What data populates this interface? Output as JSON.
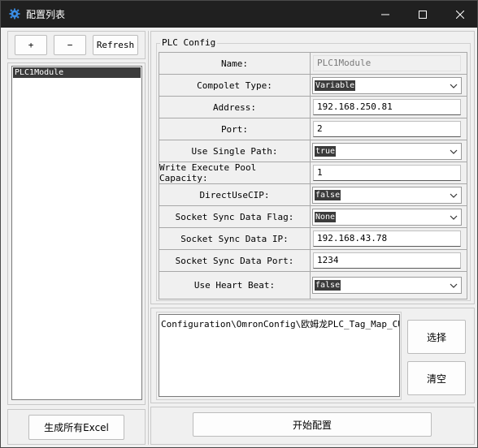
{
  "window": {
    "title": "配置列表",
    "icon": "gear-icon",
    "controls": [
      "minimize-icon",
      "maximize-icon",
      "close-icon"
    ]
  },
  "toolbar": {
    "add_label": "+",
    "remove_label": "−",
    "refresh_label": "Refresh"
  },
  "modules": [
    "PLC1Module"
  ],
  "left_bottom": {
    "generate_label": "生成所有Excel"
  },
  "plc_config": {
    "group_title": "PLC Config",
    "fields": [
      {
        "label": "Name:",
        "value": "PLC1Module",
        "kind": "readonly"
      },
      {
        "label": "Compolet Type:",
        "value": "Variable",
        "kind": "dropdown"
      },
      {
        "label": "Address:",
        "value": "192.168.250.81",
        "kind": "text"
      },
      {
        "label": "Port:",
        "value": "2",
        "kind": "text"
      },
      {
        "label": "Use Single Path:",
        "value": "true",
        "kind": "dropdown"
      },
      {
        "label": "Write Execute Pool Capacity:",
        "value": "1",
        "kind": "text"
      },
      {
        "label": "DirectUseCIP:",
        "value": "false",
        "kind": "dropdown"
      },
      {
        "label": "Socket Sync Data Flag:",
        "value": "None",
        "kind": "dropdown"
      },
      {
        "label": "Socket Sync Data IP:",
        "value": "192.168.43.78",
        "kind": "text"
      },
      {
        "label": "Socket Sync Data Port:",
        "value": "1234",
        "kind": "text"
      },
      {
        "label": "Use Heart Beat:",
        "value": "false",
        "kind": "dropdown"
      }
    ]
  },
  "files": {
    "path_text": "Configuration\\OmronConfig\\欧姆龙PLC_Tag_Map_CUT_V",
    "select_label": "选择",
    "clear_label": "清空"
  },
  "actions": {
    "start_label": "开始配置"
  },
  "colors": {
    "titlebar_bg": "#202020",
    "window_bg": "#f0f0f0",
    "selection_bg": "#3b3b3b",
    "app_icon": "#3a8ee6"
  }
}
